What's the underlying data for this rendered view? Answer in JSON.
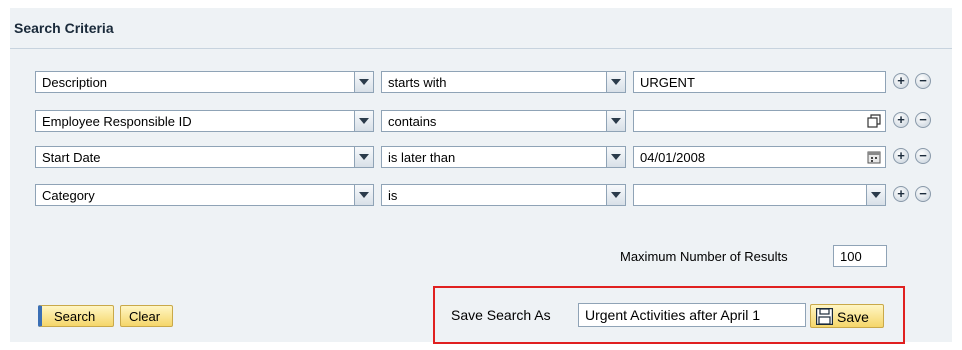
{
  "section_title": "Search Criteria",
  "criteria_rows": [
    {
      "field": "Description",
      "operator": "starts with",
      "value": "URGENT",
      "value_icon": "none"
    },
    {
      "field": "Employee Responsible ID",
      "operator": "contains",
      "value": "",
      "value_icon": "value-help-icon"
    },
    {
      "field": "Start Date",
      "operator": "is later than",
      "value": "04/01/2008",
      "value_icon": "calendar-icon"
    },
    {
      "field": "Category",
      "operator": "is",
      "value": "",
      "value_icon": "dropdown-arrow-icon"
    }
  ],
  "row_buttons": {
    "add": "+",
    "remove": "−"
  },
  "max_results": {
    "label": "Maximum Number of Results",
    "value": "100"
  },
  "actions": {
    "search_label": "Search",
    "clear_label": "Clear"
  },
  "save_search": {
    "label": "Save Search As",
    "value": "Urgent Activities after April 1",
    "save_label": "Save"
  },
  "colors": {
    "highlight_box": "#e02020",
    "button_yellow": "#f5d66a",
    "panel_bg": "#eef2f5"
  }
}
